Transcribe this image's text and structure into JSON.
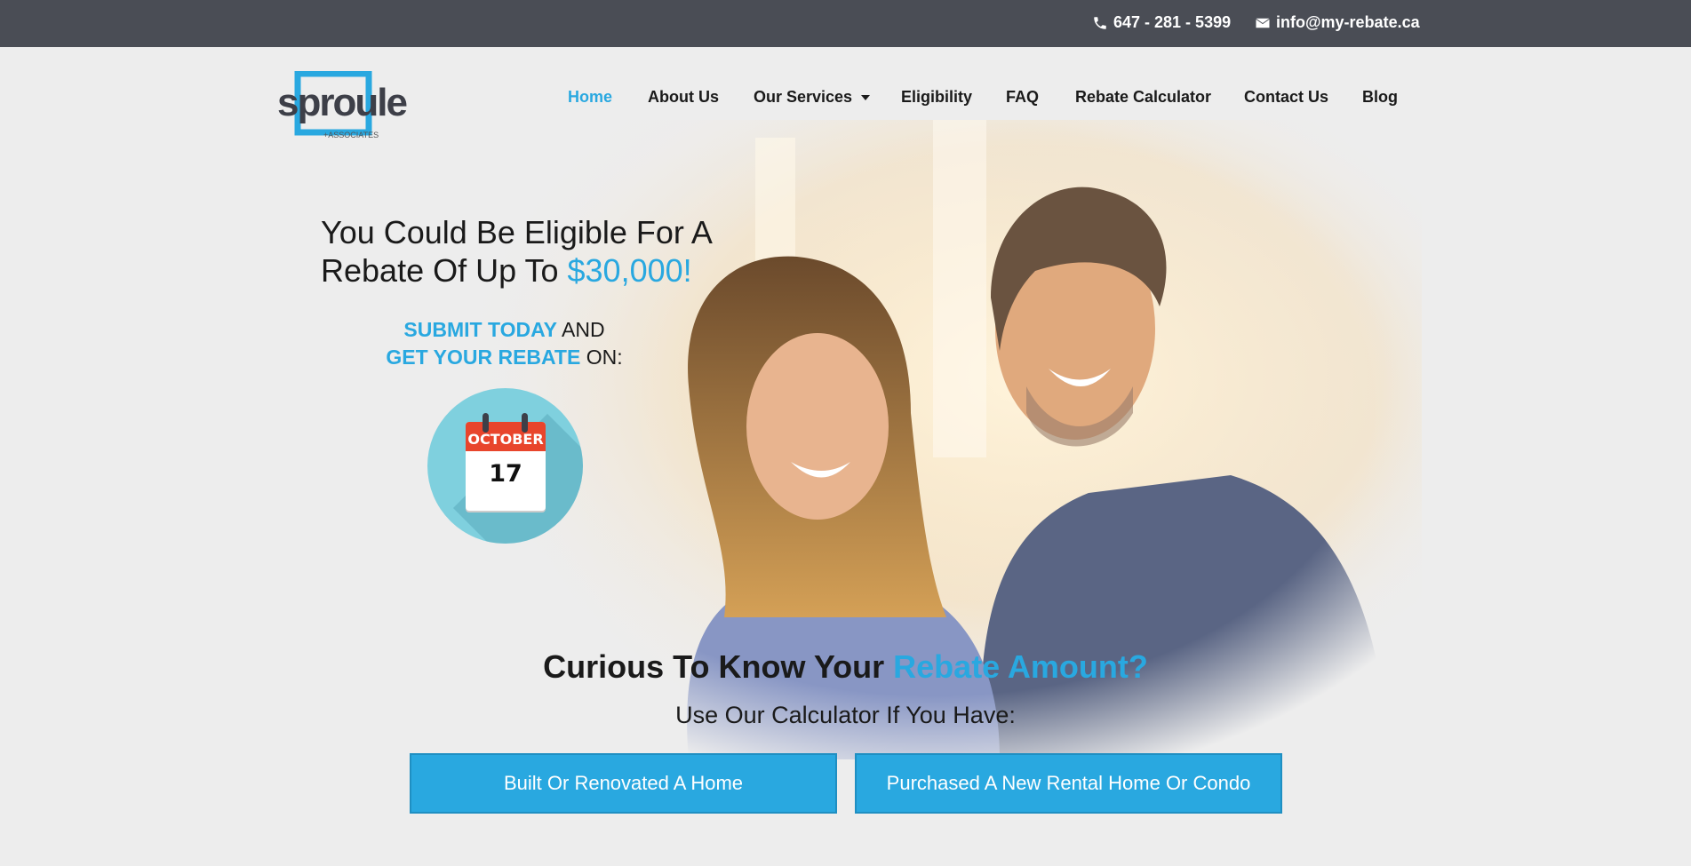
{
  "topbar": {
    "phone": "647 - 281 - 5399",
    "email": "info@my-rebate.ca",
    "phone_icon": "phone-icon",
    "email_icon": "envelope-icon",
    "background": "#4a4d55"
  },
  "logo": {
    "brand": "sproule",
    "tagline": "+ASSOCIATES"
  },
  "nav": {
    "items": [
      {
        "label": "Home",
        "active": true
      },
      {
        "label": "About Us"
      },
      {
        "label": "Our Services",
        "dropdown": true
      },
      {
        "label": "Eligibility"
      },
      {
        "label": "FAQ"
      },
      {
        "label": "Rebate Calculator"
      },
      {
        "label": "Contact Us"
      },
      {
        "label": "Blog"
      }
    ]
  },
  "hero": {
    "headline_part1": "You Could Be Eligible For A",
    "headline_part2": "Rebate Of Up To ",
    "headline_amount": "$30,000!",
    "submit_blue1": "SUBMIT TODAY",
    "submit_text1": " AND",
    "submit_blue2": "GET YOUR REBATE",
    "submit_text2": " ON:",
    "calendar_month": "OCTOBER",
    "calendar_day": "17"
  },
  "calculator": {
    "title_part1": "Curious To Know Your ",
    "title_accent": "Rebate Amount?",
    "subtitle": "Use Our Calculator If You Have:",
    "button1": "Built Or Renovated A Home",
    "button2": "Purchased A New Rental Home Or Condo"
  },
  "colors": {
    "accent": "#29a8e0",
    "calendar_red": "#e8452c",
    "badge_teal": "#7fd0de"
  }
}
